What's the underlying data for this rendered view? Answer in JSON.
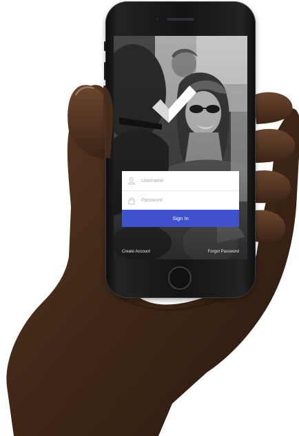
{
  "login": {
    "username_placeholder": "Username",
    "password_placeholder": "Password",
    "signin_label": "Sign In",
    "create_account_label": "Create Account",
    "forgot_password_label": "Forgot Password"
  },
  "colors": {
    "accent": "#3f51cf",
    "card": "#ffffff",
    "screen_overlay": "#3b3b3b"
  },
  "icons": [
    "checkmark-logo-icon",
    "user-icon",
    "lock-icon",
    "home-button"
  ]
}
